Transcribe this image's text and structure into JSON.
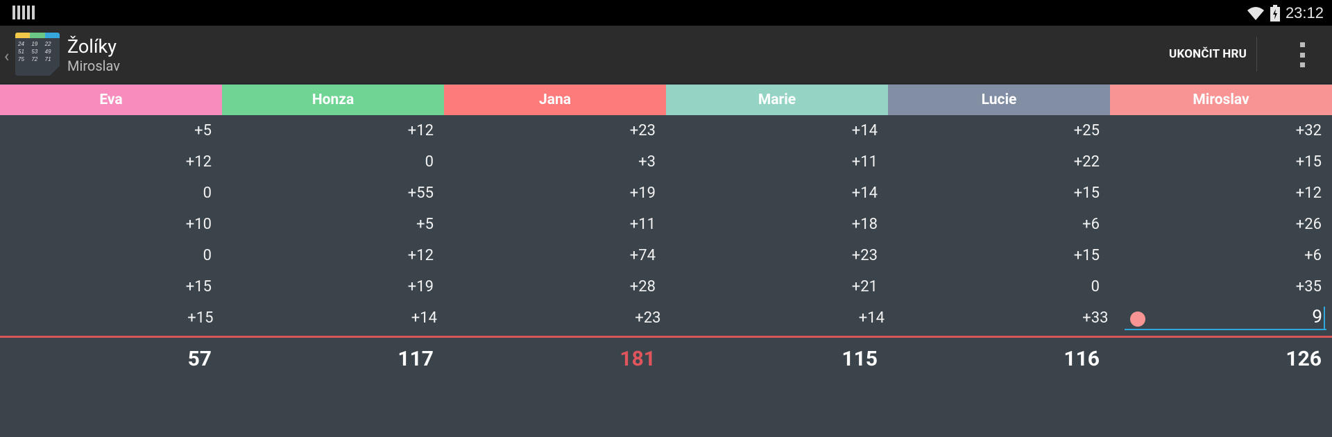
{
  "status_bar": {
    "time": "23:12",
    "icons": [
      "notification-bars-icon",
      "wifi-icon",
      "battery-icon"
    ]
  },
  "action_bar": {
    "title": "Žolíky",
    "subtitle": "Miroslav",
    "end_button": "UKONČIT HRU",
    "icon_numbers": [
      "24",
      "19",
      "22",
      "51",
      "53",
      "49",
      "75",
      "72",
      "71"
    ]
  },
  "players": [
    {
      "name": "Eva",
      "color": "#f78cbd"
    },
    {
      "name": "Honza",
      "color": "#70d494"
    },
    {
      "name": "Jana",
      "color": "#fe7b7b"
    },
    {
      "name": "Marie",
      "color": "#95d3c4"
    },
    {
      "name": "Lucie",
      "color": "#818ea3"
    },
    {
      "name": "Miroslav",
      "color": "#f89494"
    }
  ],
  "rows": [
    [
      "+5",
      "+12",
      "+23",
      "+14",
      "+25",
      "+32"
    ],
    [
      "+12",
      "0",
      "+3",
      "+11",
      "+22",
      "+15"
    ],
    [
      "0",
      "+55",
      "+19",
      "+14",
      "+15",
      "+12"
    ],
    [
      "+10",
      "+5",
      "+11",
      "+18",
      "+6",
      "+26"
    ],
    [
      "0",
      "+12",
      "+74",
      "+23",
      "+15",
      "+6"
    ],
    [
      "+15",
      "+19",
      "+28",
      "+21",
      "0",
      "+35"
    ],
    [
      "+15",
      "+14",
      "+23",
      "+14",
      "+33",
      "9"
    ]
  ],
  "totals": [
    "57",
    "117",
    "181",
    "115",
    "116",
    "126"
  ],
  "highlight_total_color": "#e0555c"
}
